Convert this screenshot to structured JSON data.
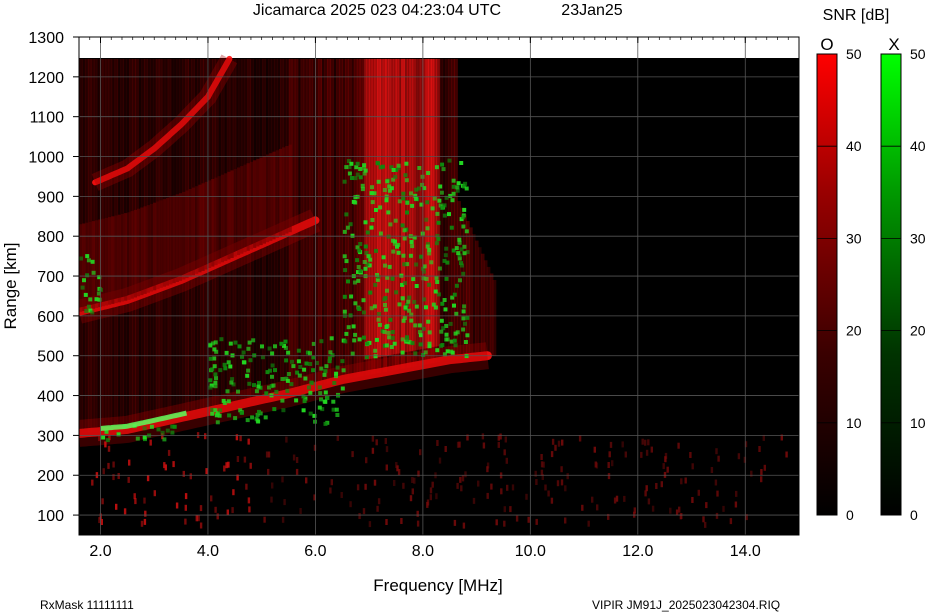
{
  "header": {
    "title": "Jicamarca 2025 023 04:23:04 UTC",
    "date": "23Jan25"
  },
  "footer": {
    "left": "RxMask 11111111",
    "right": "VIPIR  JM91J_2025023042304.RIQ"
  },
  "colorbars": {
    "title": "SNR [dB]",
    "o_label": "O",
    "x_label": "X",
    "ticks": [
      0,
      10,
      20,
      30,
      40,
      50
    ],
    "tick_labels": [
      "0",
      "10",
      "20",
      "30",
      "40",
      "50"
    ],
    "o_color_top": "#ff0000",
    "x_color_top": "#00ff00"
  },
  "chart_data": {
    "type": "heatmap",
    "title": "Jicamarca 2025 023 04:23:04 UTC",
    "xlabel": "Frequency [MHz]",
    "ylabel": "Range [km]",
    "xlim": [
      1.6,
      15.0
    ],
    "ylim": [
      50,
      1300
    ],
    "x_ticks": [
      2.0,
      4.0,
      6.0,
      8.0,
      10.0,
      12.0,
      14.0
    ],
    "x_tick_labels": [
      "2.0",
      "4.0",
      "6.0",
      "8.0",
      "10.0",
      "12.0",
      "14.0"
    ],
    "y_ticks": [
      100,
      200,
      300,
      400,
      500,
      600,
      700,
      800,
      900,
      1000,
      1100,
      1200,
      1300
    ],
    "y_tick_labels": [
      "100",
      "200",
      "300",
      "400",
      "500",
      "600",
      "700",
      "800",
      "900",
      "1000",
      "1100",
      "1200",
      "1300"
    ],
    "grid": true,
    "data_ceiling_km": 1245,
    "colorscale": {
      "unit": "SNR [dB]",
      "min": 0,
      "max": 50
    },
    "series": [
      {
        "name": "O",
        "trace_order_1": {
          "freq_mhz": [
            1.6,
            2.5,
            3.5,
            4.5,
            5.5,
            6.5,
            7.5,
            8.5,
            9.2
          ],
          "range_km": [
            305,
            315,
            345,
            375,
            405,
            440,
            465,
            490,
            500
          ]
        },
        "trace_order_2": {
          "freq_mhz": [
            1.6,
            2.5,
            3.5,
            4.5,
            5.5,
            6.0
          ],
          "range_km": [
            610,
            640,
            690,
            750,
            810,
            840
          ]
        },
        "trace_order_3": {
          "freq_mhz": [
            1.9,
            2.5,
            3.0,
            3.5,
            4.0,
            4.4
          ],
          "range_km": [
            935,
            970,
            1020,
            1080,
            1150,
            1245
          ]
        }
      },
      {
        "name": "X",
        "patches": [
          {
            "freq_mhz": [
              1.6,
              2.0
            ],
            "range_km": [
              600,
              760
            ]
          },
          {
            "freq_mhz": [
              2.0,
              3.5
            ],
            "range_km": [
              290,
              330
            ]
          },
          {
            "freq_mhz": [
              4.0,
              6.5
            ],
            "range_km": [
              330,
              550
            ]
          },
          {
            "freq_mhz": [
              6.5,
              8.8
            ],
            "range_km": [
              500,
              1000
            ]
          }
        ]
      }
    ]
  }
}
